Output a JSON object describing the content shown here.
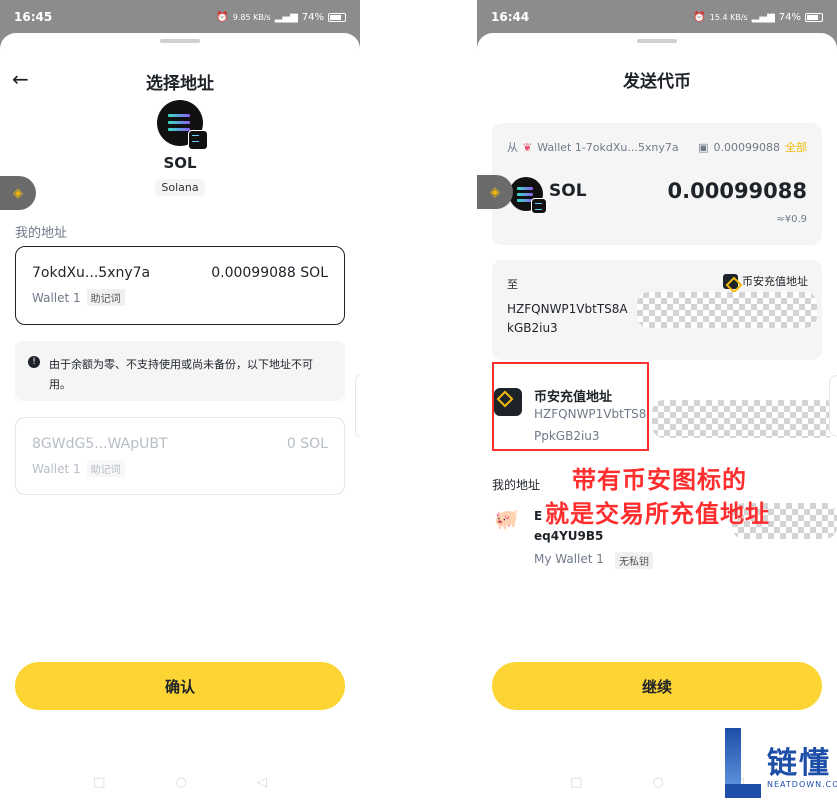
{
  "left": {
    "time": "16:45",
    "net_speed": "9.85 KB/s",
    "battery": "74%",
    "title": "选择地址",
    "coin_symbol": "SOL",
    "network": "Solana",
    "section_label": "我的地址",
    "wallet1_address": "7okdXu...5xny7a",
    "wallet1_balance": "0.00099088 SOL",
    "wallet1_name": "Wallet 1",
    "wallet1_tag": "助记词",
    "notice": "由于余额为零、不支持使用或尚未备份，以下地址不可用。",
    "wallet2_address": "8GWdG5...WApUBT",
    "wallet2_balance": "0 SOL",
    "wallet2_name": "Wallet 1",
    "wallet2_tag": "助记词",
    "confirm_label": "确认"
  },
  "right": {
    "time": "16:44",
    "net_speed": "15.4 KB/s",
    "battery": "74%",
    "title": "发送代币",
    "from_label": "从",
    "from_wallet": "Wallet 1-7okdXu...5xny7a",
    "from_balance": "0.00099088",
    "all_label": "全部",
    "coin_symbol": "SOL",
    "amount": "0.00099088",
    "fiat": "≈¥0.9",
    "to_label": "至",
    "binance_label": "币安充值地址",
    "to_address_line1": "HZFQNWP1VbtTS8A",
    "to_address_line2": "kGB2iu3",
    "suggest_title": "币安充值地址",
    "suggest_line1": "HZFQNWP1VbtTS8",
    "suggest_line2": "PpkGB2iu3",
    "my_address_label": "我的地址",
    "my_addr_line1": "E",
    "my_addr_line2": "eq4YU9B5",
    "my_wallet_name": "My Wallet 1",
    "my_wallet_tag": "无私钥",
    "continue_label": "继续"
  },
  "annotation": {
    "line1": "带有币安图标的",
    "line2": "就是交易所充值地址"
  },
  "watermark": {
    "brand": "链懂",
    "domain": "NEATDOWN.COM"
  },
  "colors": {
    "accent_yellow": "#fcd535",
    "binance_gold": "#f0b90b",
    "annotation_red": "#ff2d2d"
  }
}
